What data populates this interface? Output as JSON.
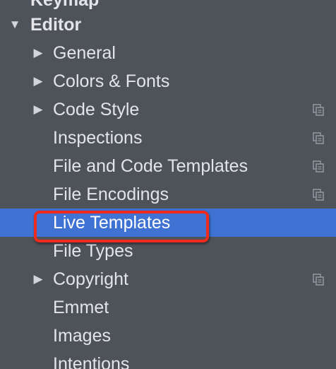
{
  "tree": {
    "items": [
      {
        "label": "Keymap"
      },
      {
        "label": "Editor"
      },
      {
        "label": "General"
      },
      {
        "label": "Colors & Fonts"
      },
      {
        "label": "Code Style"
      },
      {
        "label": "Inspections"
      },
      {
        "label": "File and Code Templates"
      },
      {
        "label": "File Encodings"
      },
      {
        "label": "Live Templates"
      },
      {
        "label": "File Types"
      },
      {
        "label": "Copyright"
      },
      {
        "label": "Emmet"
      },
      {
        "label": "Images"
      },
      {
        "label": "Intentions"
      }
    ]
  },
  "colors": {
    "background": "#4e5259",
    "selection": "#3f72d2",
    "highlight_border": "#ee2b1d"
  },
  "icons": {
    "expand": "triangle-right",
    "collapse": "triangle-down",
    "project_scope": "copy-icon"
  }
}
